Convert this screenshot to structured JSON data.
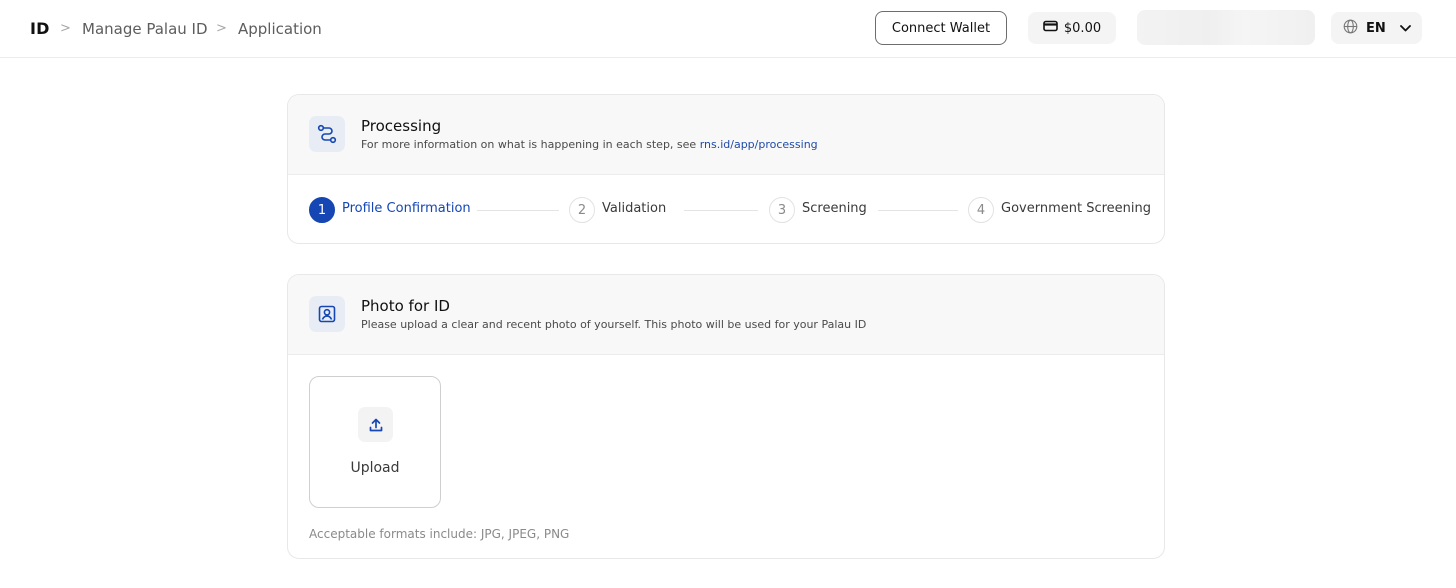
{
  "breadcrumb": {
    "root": "ID",
    "items": [
      "Manage Palau ID",
      "Application"
    ],
    "separator": ">"
  },
  "header": {
    "connect_wallet_label": "Connect Wallet",
    "balance": "$0.00",
    "language": "EN"
  },
  "processing": {
    "title": "Processing",
    "subtitle": "For more information on what is happening in each step, see",
    "link": "rns.id/app/processing",
    "steps": [
      {
        "number": "1",
        "label": "Profile Confirmation",
        "active": true
      },
      {
        "number": "2",
        "label": "Validation",
        "active": false
      },
      {
        "number": "3",
        "label": "Screening",
        "active": false
      },
      {
        "number": "4",
        "label": "Government Screening",
        "active": false
      }
    ]
  },
  "photo": {
    "title": "Photo for ID",
    "subtitle": "Please upload a clear and recent photo of yourself. This photo will be used for your Palau ID",
    "upload_label": "Upload",
    "formats": "Acceptable formats include: JPG, JPEG, PNG"
  },
  "colors": {
    "accent": "#1546b3",
    "link": "#1f4aa8",
    "card_header_bg": "#f8f8f8"
  },
  "icons": {
    "processing": "route-icon",
    "photo": "portrait-icon",
    "upload": "upload-arrow-icon",
    "balance": "wallet-icon",
    "language": "globe-icon",
    "dropdown": "chevron-down-icon"
  }
}
